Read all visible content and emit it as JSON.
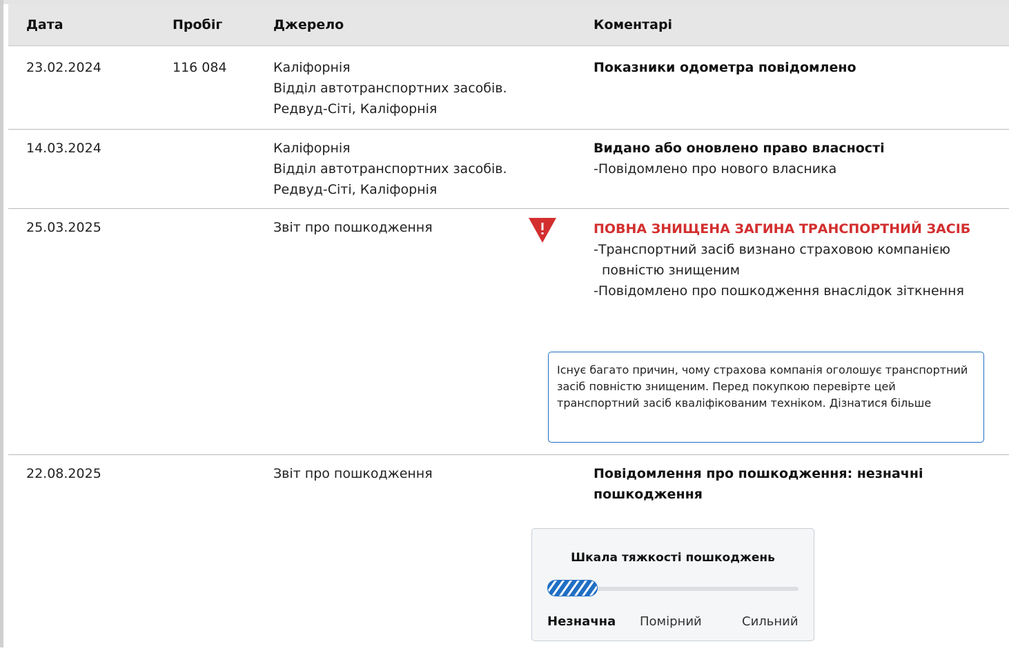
{
  "table": {
    "headers": {
      "date": "Дата",
      "mileage": "Пробіг",
      "source": "Джерело",
      "comments": "Коментарі"
    },
    "rows": [
      {
        "date": "23.02.2024",
        "mileage": "116 084",
        "source": [
          "Каліфорнія",
          "Відділ автотранспортних засобів.",
          "Редвуд-Сіті, Каліфорнія"
        ],
        "title": "Показники одометра повідомлено"
      },
      {
        "date": "14.03.2024",
        "mileage": "",
        "source": [
          "Каліфорнія",
          "Відділ автотранспортних засобів.",
          "Редвуд-Сіті, Каліфорнія"
        ],
        "title": "Видано або оновлено право власності",
        "bullets": [
          "-Повідомлено про нового власника"
        ]
      },
      {
        "date": "25.03.2025",
        "mileage": "",
        "source": [
          "Звіт про пошкодження"
        ],
        "alert_title": "ПОВНА ЗНИЩЕНА ЗАГИНА ТРАНСПОРТНИЙ ЗАСІБ",
        "bullets": [
          "-Транспортний засіб визнано страховою компанією повністю знищеним",
          "-Повідомлено про пошкодження внаслідок зіткнення"
        ],
        "note": {
          "text": "Існує багато причин, чому страхова компанія оголошує транспортний засіб повністю знищеним. Перед покупкою перевірте цей транспортний засіб кваліфікованим техніком.",
          "link": "Дізнатися більше"
        }
      },
      {
        "date": "22.08.2025",
        "mileage": "",
        "source": [
          "Звіт про пошкодження"
        ],
        "title": "Повідомлення про пошкодження: незначні пошкодження",
        "severity": {
          "title": "Шкала тяжкості пошкоджень",
          "levels": [
            "Незначна",
            "Помірний",
            "Сильний"
          ],
          "selected": "Незначна",
          "fill_fraction": 0.2
        }
      }
    ]
  },
  "colors": {
    "alert": "#d32f2f",
    "accent": "#1f6fc4",
    "header_bg": "#e6e6e6"
  },
  "icons": {
    "warning": "warning-triangle-icon"
  }
}
